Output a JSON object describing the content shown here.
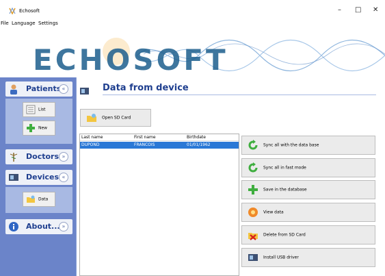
{
  "window": {
    "title": "Echosoft",
    "minimize": "–",
    "maximize": "□",
    "close": "✕"
  },
  "menu": [
    "File",
    "Language",
    "Settings"
  ],
  "banner": {
    "logo": "ECHOSOFT"
  },
  "sidebar": {
    "patients": {
      "label": "Patients",
      "chevron": "«",
      "buttons": [
        "List",
        "New"
      ]
    },
    "doctors": {
      "label": "Doctors",
      "chevron": "»"
    },
    "devices": {
      "label": "Devices",
      "chevron": "«",
      "buttons": [
        "Data"
      ]
    },
    "about": {
      "label": "About...",
      "chevron": "»"
    }
  },
  "main": {
    "title": "Data from device",
    "open_sd": "Open SD Card",
    "table": {
      "columns": [
        "Last name",
        "First name",
        "Birthdate"
      ],
      "rows": [
        [
          "DUPOND",
          "FRANCOIS",
          "01/01/1962"
        ]
      ]
    },
    "actions": [
      "Sync all with the data base",
      "Sync all in fast mode",
      "Save in the database",
      "View data",
      "Delete from SD Card",
      "Install USB driver"
    ]
  }
}
